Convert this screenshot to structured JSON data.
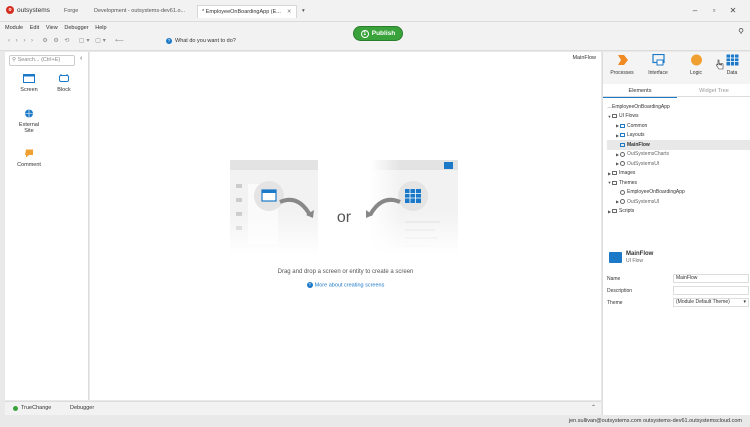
{
  "app": {
    "logo_text": "outsystems"
  },
  "tabs": [
    {
      "label": "Forge"
    },
    {
      "label": "Development - outsystems-dev61.o..."
    },
    {
      "label": "* EmployeeOnBoardingApp (E..."
    }
  ],
  "menu": [
    "Module",
    "Edit",
    "View",
    "Debugger",
    "Help"
  ],
  "toolbar": {
    "prompt": "What do you want to do?"
  },
  "publish": {
    "step": "1",
    "label": "Publish"
  },
  "left_panel": {
    "search_placeholder": "Search... (Ctrl+E)",
    "widgets": [
      {
        "label": "Screen",
        "icon": "screen-icon"
      },
      {
        "label": "Block",
        "icon": "block-icon"
      },
      {
        "label": "External Site",
        "icon": "globe-icon"
      },
      {
        "label": "Comment",
        "icon": "comment-icon"
      }
    ]
  },
  "canvas": {
    "flow_label": "MainFlow",
    "or_text": "or",
    "drop_message": "Drag and drop a screen or entity to create a screen",
    "more_link": "More about creating screens"
  },
  "right_panel": {
    "tabs": [
      {
        "label": "Processes",
        "color": "#f08a24"
      },
      {
        "label": "Interface",
        "color": "#1c79c7"
      },
      {
        "label": "Logic",
        "color": "#f0a030"
      },
      {
        "label": "Data",
        "color": "#1c79c7"
      }
    ],
    "subtabs": [
      "Elements",
      "Widget Tree"
    ],
    "tree": [
      {
        "label": "EmployeeOnBoardingApp",
        "depth": 0,
        "arrow": "—",
        "icon": "none"
      },
      {
        "label": "UI Flows",
        "depth": 0,
        "arrow": "▼",
        "icon": "folder"
      },
      {
        "label": "Common",
        "depth": 1,
        "arrow": "▶",
        "icon": "folder"
      },
      {
        "label": "Layouts",
        "depth": 1,
        "arrow": "▶",
        "icon": "folder"
      },
      {
        "label": "MainFlow",
        "depth": 1,
        "arrow": "",
        "icon": "folder",
        "selected": true
      },
      {
        "label": "OutSystemsCharts",
        "depth": 1,
        "arrow": "▶",
        "icon": "gear",
        "dim": true
      },
      {
        "label": "OutSystemsUI",
        "depth": 1,
        "arrow": "▶",
        "icon": "gear",
        "dim": true
      },
      {
        "label": "Images",
        "depth": 0,
        "arrow": "▶",
        "icon": "folder"
      },
      {
        "label": "Themes",
        "depth": 0,
        "arrow": "▼",
        "icon": "folder"
      },
      {
        "label": "EmployeeOnBoardingApp",
        "depth": 1,
        "arrow": "",
        "icon": "gear"
      },
      {
        "label": "OutSystemsUI",
        "depth": 1,
        "arrow": "▶",
        "icon": "gear",
        "dim": true
      },
      {
        "label": "Scripts",
        "depth": 0,
        "arrow": "▶",
        "icon": "folder"
      }
    ],
    "properties": {
      "title": "MainFlow",
      "type": "UI Flow",
      "rows": [
        {
          "label": "Name",
          "value": "MainFlow"
        },
        {
          "label": "Description",
          "value": ""
        },
        {
          "label": "Theme",
          "value": "(Module Default Theme)"
        }
      ]
    }
  },
  "bottom": {
    "tabs": [
      {
        "label": "TrueChange"
      },
      {
        "label": "Debugger"
      }
    ]
  },
  "status": {
    "text": "jen.sullivan@outsystems.com   outsystems-dev61.outsystemscloud.com"
  }
}
